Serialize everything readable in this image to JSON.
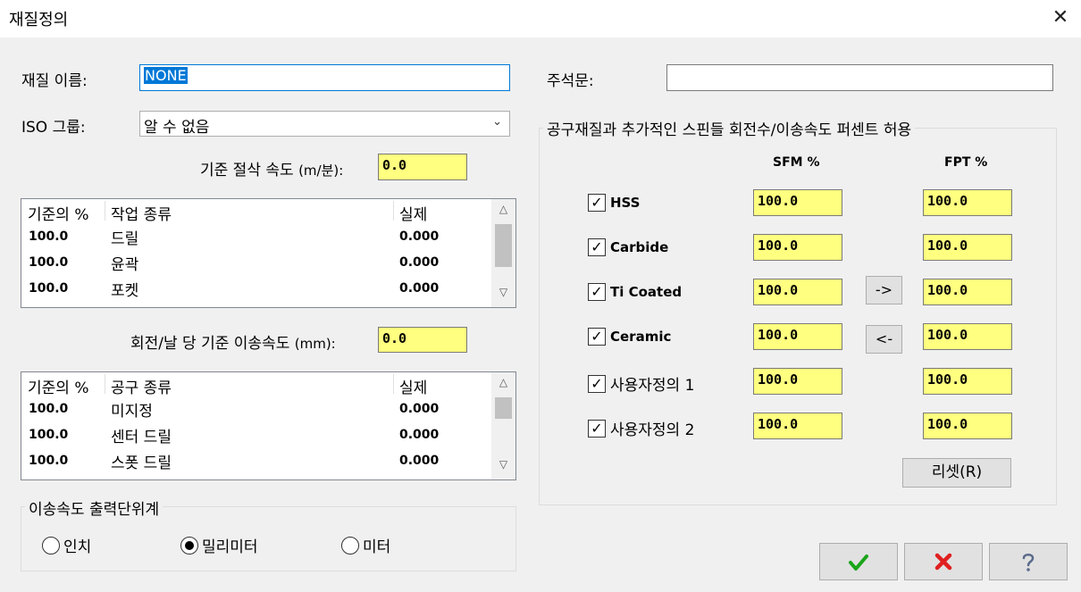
{
  "window": {
    "title": "재질정의",
    "close_glyph": "✕"
  },
  "material": {
    "name_label": "재질 이름:",
    "name_value": "NONE",
    "iso_label": "ISO 그룹:",
    "iso_value": "알 수 없음",
    "comment_label": "주석문:",
    "comment_value": ""
  },
  "cut_speed": {
    "label_pre": "기준 절삭 속도 ",
    "label_unit": "(m/분):",
    "value": "0.0"
  },
  "op_list": {
    "headers": [
      "기준의 %",
      "작업 종류",
      "실제"
    ],
    "rows": [
      {
        "pct": "100.0",
        "name": "드릴",
        "actual": "0.000"
      },
      {
        "pct": "100.0",
        "name": "윤곽",
        "actual": "0.000"
      },
      {
        "pct": "100.0",
        "name": "포켓",
        "actual": "0.000"
      }
    ]
  },
  "feed": {
    "label_pre": "회전/날 당 기준 이송속도 ",
    "label_unit": "(mm):",
    "value": "0.0"
  },
  "tool_list": {
    "headers": [
      "기준의 %",
      "공구 종류",
      "실제"
    ],
    "rows": [
      {
        "pct": "100.0",
        "name": "미지정",
        "actual": "0.000"
      },
      {
        "pct": "100.0",
        "name": "센터 드릴",
        "actual": "0.000"
      },
      {
        "pct": "100.0",
        "name": "스폿 드릴",
        "actual": "0.000"
      }
    ]
  },
  "feed_units": {
    "group_label": "이송속도 출력단위계",
    "options": [
      "인치",
      "밀리미터",
      "미터"
    ],
    "selected": "밀리미터"
  },
  "tool_material": {
    "group_label": "공구재질과 추가적인 스핀들 회전수/이송속도 퍼센트 허용",
    "sfm_header": "SFM %",
    "fpt_header": "FPT %",
    "rows": [
      {
        "label": "HSS",
        "checked": true,
        "sfm": "100.0",
        "fpt": "100.0"
      },
      {
        "label": "Carbide",
        "checked": true,
        "sfm": "100.0",
        "fpt": "100.0"
      },
      {
        "label": "Ti Coated",
        "checked": true,
        "sfm": "100.0",
        "fpt": "100.0"
      },
      {
        "label": "Ceramic",
        "checked": true,
        "sfm": "100.0",
        "fpt": "100.0"
      },
      {
        "label": "사용자정의 1",
        "checked": true,
        "sfm": "100.0",
        "fpt": "100.0"
      },
      {
        "label": "사용자정의 2",
        "checked": true,
        "sfm": "100.0",
        "fpt": "100.0"
      }
    ],
    "copy_right_label": "->",
    "copy_left_label": "<-",
    "reset_label": "리셋(R)"
  },
  "footer": {
    "ok_icon": "check-icon",
    "cancel_icon": "x-icon",
    "help_icon": "question-icon",
    "colors": {
      "ok": "#1aa51a",
      "cancel": "#e02020",
      "help": "#5a6a8a"
    }
  }
}
